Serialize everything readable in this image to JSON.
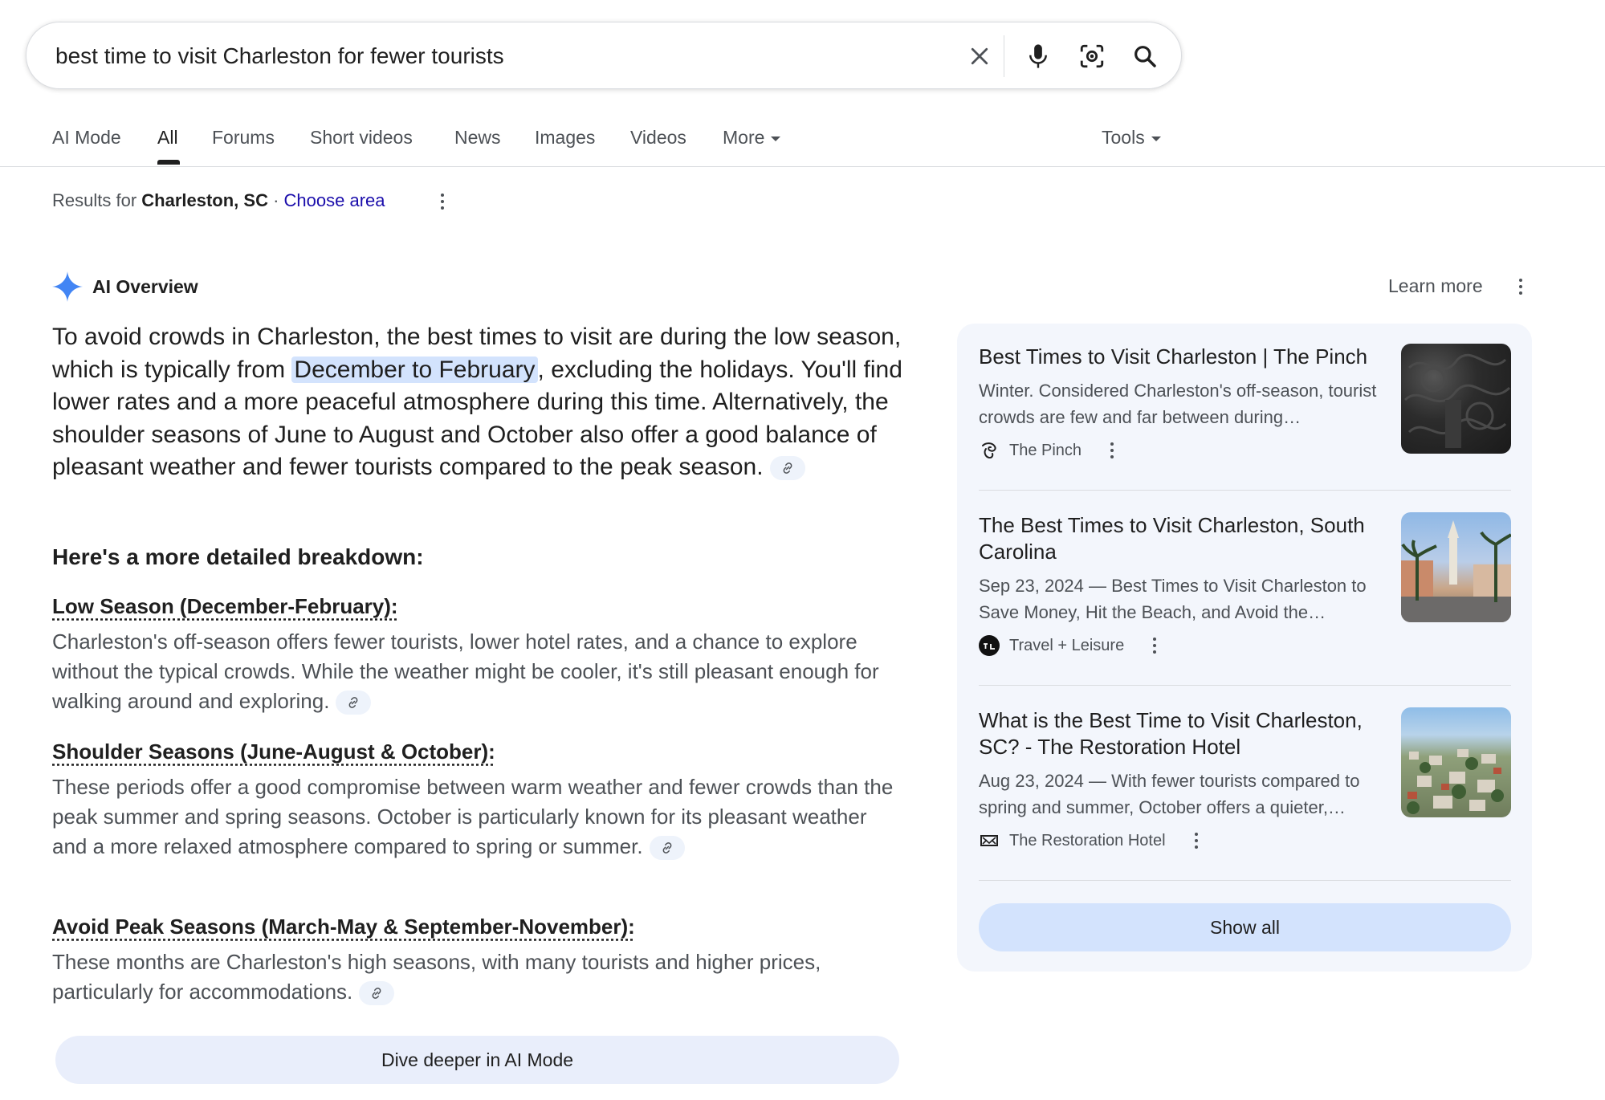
{
  "search": {
    "query": "best time to visit Charleston for fewer tourists",
    "icons": [
      "close-icon",
      "microphone-icon",
      "lens-camera-icon",
      "search-icon"
    ]
  },
  "tabs": [
    {
      "label": "AI Mode"
    },
    {
      "label": "All",
      "active": true
    },
    {
      "label": "Forums"
    },
    {
      "label": "Short videos"
    },
    {
      "label": "News"
    },
    {
      "label": "Images"
    },
    {
      "label": "Videos"
    },
    {
      "label": "More"
    },
    {
      "label": "Tools"
    }
  ],
  "location": {
    "prefix": "Results for ",
    "place": "Charleston, SC",
    "separator": " · ",
    "choose": "Choose area"
  },
  "ai_overview": {
    "title": "AI Overview",
    "learn_more": "Learn more",
    "lead_part1": "To avoid crowds in Charleston, the best times to visit are during the low season, which is typically from ",
    "lead_highlight": "December to February",
    "lead_part2": ", excluding the holidays. You'll find lower rates and a more peaceful atmosphere during this time. Alternatively, the shoulder seasons of June to August and October also offer a good balance of pleasant weather and fewer tourists compared to the peak season.",
    "breakdown_heading": "Here's a more detailed breakdown:",
    "sections": [
      {
        "title": "Low Season (December-February):",
        "body": "Charleston's off-season offers fewer tourists, lower hotel rates, and a chance to explore without the typical crowds. While the weather might be cooler, it's still pleasant enough for walking around and exploring."
      },
      {
        "title": "Shoulder Seasons (June-August & October):",
        "body": "These periods offer a good compromise between warm weather and fewer crowds than the peak summer and spring seasons. October is particularly known for its pleasant weather and a more relaxed atmosphere compared to spring or summer."
      },
      {
        "title": "Avoid Peak Seasons (March-May & September-November):",
        "body": "These months are Charleston's high seasons, with many tourists and higher prices, particularly for accommodations."
      }
    ],
    "dive_deeper": "Dive deeper in AI Mode"
  },
  "sources": [
    {
      "title": "Best Times to Visit Charleston | The Pinch",
      "snippet": "Winter. Considered Charleston's off-season, tourist crowds are few and far between during…",
      "site": "The Pinch"
    },
    {
      "title": "The Best Times to Visit Charleston, South Carolina",
      "snippet": "Sep 23, 2024 — Best Times to Visit Charleston to Save Money, Hit the Beach, and Avoid the…",
      "site": "Travel + Leisure"
    },
    {
      "title": "What is the Best Time to Visit Charleston, SC? - The Restoration Hotel",
      "snippet": "Aug 23, 2024 — With fewer tourists compared to spring and summer, October offers a quieter,…",
      "site": "The Restoration Hotel"
    }
  ],
  "show_all": "Show all",
  "colors": {
    "link": "#1a0dab",
    "highlight": "#d3e3fd",
    "panel_bg": "#f3f6fc",
    "ai_star": "#4285f4"
  }
}
